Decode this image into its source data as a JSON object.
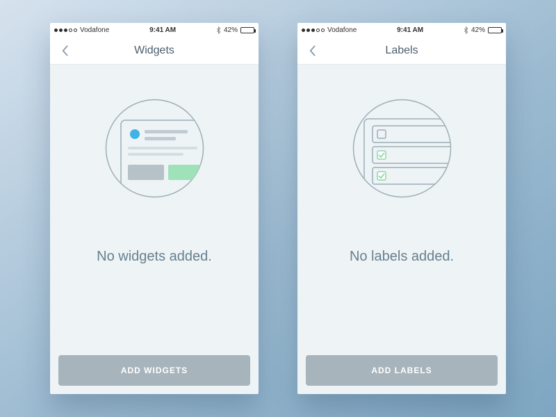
{
  "status": {
    "carrier": "Vodafone",
    "time": "9:41 AM",
    "battery_pct": "42%"
  },
  "screens": [
    {
      "title": "Widgets",
      "message": "No widgets added.",
      "cta": "ADD WIDGETS"
    },
    {
      "title": "Labels",
      "message": "No labels added.",
      "cta": "ADD LABELS"
    }
  ]
}
